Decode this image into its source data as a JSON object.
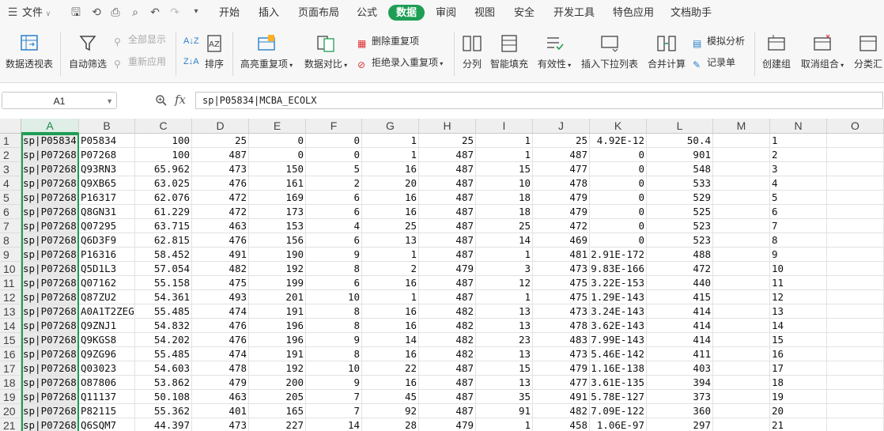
{
  "menubar": {
    "file_label": "文件",
    "tabs": [
      "开始",
      "插入",
      "页面布局",
      "公式",
      "数据",
      "审阅",
      "视图",
      "安全",
      "开发工具",
      "特色应用",
      "文档助手"
    ],
    "active_tab": "数据"
  },
  "ribbon": {
    "pivot": "数据透视表",
    "autofilter": "自动筛选",
    "show_all": "全部显示",
    "reapply": "重新应用",
    "sort": "排序",
    "highlight_dup": "高亮重复项",
    "compare": "数据对比",
    "remove_dup": "删除重复项",
    "reject_dup": "拒绝录入重复项",
    "split": "分列",
    "smart_fill": "智能填充",
    "validity": "有效性",
    "dropdown": "插入下拉列表",
    "consolidate": "合并计算",
    "whatif": "模拟分析",
    "record": "记录单",
    "create_group": "创建组",
    "ungroup": "取消组合",
    "subtotal": "分类汇"
  },
  "formula_bar": {
    "name_box": "A1",
    "fx": "fx",
    "formula": "sp|P05834|MCBA_ECOLX"
  },
  "columns": [
    "A",
    "B",
    "C",
    "D",
    "E",
    "F",
    "G",
    "H",
    "I",
    "J",
    "K",
    "L",
    "M",
    "N",
    "O"
  ],
  "rows": [
    {
      "n": "1",
      "a": "sp|P05834",
      "b": "P05834",
      "c": "100",
      "d": "25",
      "e": "0",
      "f": "0",
      "g": "1",
      "h": "25",
      "i": "1",
      "j": "25",
      "k": "4.92E-12",
      "l": "50.4"
    },
    {
      "n": "2",
      "a": "sp|P07268",
      "b": "P07268",
      "c": "100",
      "d": "487",
      "e": "0",
      "f": "0",
      "g": "1",
      "h": "487",
      "i": "1",
      "j": "487",
      "k": "0",
      "l": "901"
    },
    {
      "n": "3",
      "a": "sp|P07268",
      "b": "Q93RN3",
      "c": "65.962",
      "d": "473",
      "e": "150",
      "f": "5",
      "g": "16",
      "h": "487",
      "i": "15",
      "j": "477",
      "k": "0",
      "l": "548"
    },
    {
      "n": "4",
      "a": "sp|P07268",
      "b": "Q9XB65",
      "c": "63.025",
      "d": "476",
      "e": "161",
      "f": "2",
      "g": "20",
      "h": "487",
      "i": "10",
      "j": "478",
      "k": "0",
      "l": "533"
    },
    {
      "n": "5",
      "a": "sp|P07268",
      "b": "P16317",
      "c": "62.076",
      "d": "472",
      "e": "169",
      "f": "6",
      "g": "16",
      "h": "487",
      "i": "18",
      "j": "479",
      "k": "0",
      "l": "529"
    },
    {
      "n": "6",
      "a": "sp|P07268",
      "b": "Q8GN31",
      "c": "61.229",
      "d": "472",
      "e": "173",
      "f": "6",
      "g": "16",
      "h": "487",
      "i": "18",
      "j": "479",
      "k": "0",
      "l": "525"
    },
    {
      "n": "7",
      "a": "sp|P07268",
      "b": "Q07295",
      "c": "63.715",
      "d": "463",
      "e": "153",
      "f": "4",
      "g": "25",
      "h": "487",
      "i": "25",
      "j": "472",
      "k": "0",
      "l": "523"
    },
    {
      "n": "8",
      "a": "sp|P07268",
      "b": "Q6D3F9",
      "c": "62.815",
      "d": "476",
      "e": "156",
      "f": "6",
      "g": "13",
      "h": "487",
      "i": "14",
      "j": "469",
      "k": "0",
      "l": "523"
    },
    {
      "n": "9",
      "a": "sp|P07268",
      "b": "P16316",
      "c": "58.452",
      "d": "491",
      "e": "190",
      "f": "9",
      "g": "1",
      "h": "487",
      "i": "1",
      "j": "481",
      "k": "2.91E-172",
      "l": "488"
    },
    {
      "n": "10",
      "a": "sp|P07268",
      "b": "Q5D1L3",
      "c": "57.054",
      "d": "482",
      "e": "192",
      "f": "8",
      "g": "2",
      "h": "479",
      "i": "3",
      "j": "473",
      "k": "9.83E-166",
      "l": "472"
    },
    {
      "n": "11",
      "a": "sp|P07268",
      "b": "Q07162",
      "c": "55.158",
      "d": "475",
      "e": "199",
      "f": "6",
      "g": "16",
      "h": "487",
      "i": "12",
      "j": "475",
      "k": "3.22E-153",
      "l": "440"
    },
    {
      "n": "12",
      "a": "sp|P07268",
      "b": "Q87ZU2",
      "c": "54.361",
      "d": "493",
      "e": "201",
      "f": "10",
      "g": "1",
      "h": "487",
      "i": "1",
      "j": "475",
      "k": "1.29E-143",
      "l": "415"
    },
    {
      "n": "13",
      "a": "sp|P07268",
      "b": "A0A1T2ZEG",
      "c": "55.485",
      "d": "474",
      "e": "191",
      "f": "8",
      "g": "16",
      "h": "482",
      "i": "13",
      "j": "473",
      "k": "3.24E-143",
      "l": "414"
    },
    {
      "n": "14",
      "a": "sp|P07268",
      "b": "Q9ZNJ1",
      "c": "54.832",
      "d": "476",
      "e": "196",
      "f": "8",
      "g": "16",
      "h": "482",
      "i": "13",
      "j": "478",
      "k": "3.62E-143",
      "l": "414"
    },
    {
      "n": "15",
      "a": "sp|P07268",
      "b": "Q9KGS8",
      "c": "54.202",
      "d": "476",
      "e": "196",
      "f": "9",
      "g": "14",
      "h": "482",
      "i": "23",
      "j": "483",
      "k": "7.99E-143",
      "l": "414"
    },
    {
      "n": "16",
      "a": "sp|P07268",
      "b": "Q9ZG96",
      "c": "55.485",
      "d": "474",
      "e": "191",
      "f": "8",
      "g": "16",
      "h": "482",
      "i": "13",
      "j": "473",
      "k": "5.46E-142",
      "l": "411"
    },
    {
      "n": "17",
      "a": "sp|P07268",
      "b": "Q03023",
      "c": "54.603",
      "d": "478",
      "e": "192",
      "f": "10",
      "g": "22",
      "h": "487",
      "i": "15",
      "j": "479",
      "k": "1.16E-138",
      "l": "403"
    },
    {
      "n": "18",
      "a": "sp|P07268",
      "b": "O87806",
      "c": "53.862",
      "d": "479",
      "e": "200",
      "f": "9",
      "g": "16",
      "h": "487",
      "i": "13",
      "j": "477",
      "k": "3.61E-135",
      "l": "394"
    },
    {
      "n": "19",
      "a": "sp|P07268",
      "b": "Q11137",
      "c": "50.108",
      "d": "463",
      "e": "205",
      "f": "7",
      "g": "45",
      "h": "487",
      "i": "35",
      "j": "491",
      "k": "5.78E-127",
      "l": "373"
    },
    {
      "n": "20",
      "a": "sp|P07268",
      "b": "P82115",
      "c": "55.362",
      "d": "401",
      "e": "165",
      "f": "7",
      "g": "92",
      "h": "487",
      "i": "91",
      "j": "482",
      "k": "7.09E-122",
      "l": "360"
    },
    {
      "n": "21",
      "a": "sp|P07268",
      "b": "Q6SQM7",
      "c": "44.397",
      "d": "473",
      "e": "227",
      "f": "14",
      "g": "28",
      "h": "479",
      "i": "1",
      "j": "458",
      "k": "1.06E-97",
      "l": "297"
    }
  ],
  "colors": {
    "accent": "#1e9e54",
    "header_bg": "#efefef",
    "selected_header": "#dfeee6"
  }
}
